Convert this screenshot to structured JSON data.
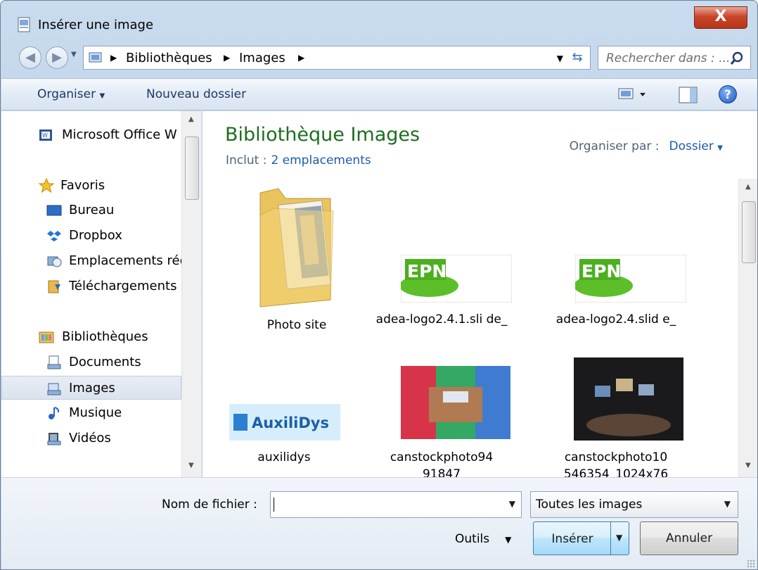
{
  "window": {
    "title": "Insérer une image",
    "close_label": "X"
  },
  "address": {
    "breadcrumbs": [
      "Bibliothèques",
      "Images"
    ],
    "search_placeholder": "Rechercher dans : ..."
  },
  "toolbar": {
    "organize_label": "Organiser",
    "new_folder_label": "Nouveau dossier",
    "help_label": "?"
  },
  "nav": {
    "items": [
      {
        "label": "Microsoft Office W",
        "icon": "word-icon"
      },
      {
        "label": "Favoris",
        "icon": "star-icon"
      },
      {
        "label": "Bureau",
        "icon": "desktop-icon"
      },
      {
        "label": "Dropbox",
        "icon": "dropbox-icon"
      },
      {
        "label": "Emplacements réc",
        "icon": "recent-places-icon"
      },
      {
        "label": "Téléchargements",
        "icon": "downloads-icon"
      },
      {
        "label": "Bibliothèques",
        "icon": "libraries-icon"
      },
      {
        "label": "Documents",
        "icon": "documents-icon"
      },
      {
        "label": "Images",
        "icon": "pictures-icon",
        "selected": true
      },
      {
        "label": "Musique",
        "icon": "music-icon"
      },
      {
        "label": "Vidéos",
        "icon": "videos-icon"
      }
    ]
  },
  "content": {
    "title": "Bibliothèque Images",
    "include_label": "Inclut :",
    "include_link": "2 emplacements",
    "arrange_label": "Organiser par :",
    "arrange_value": "Dossier",
    "tiles": [
      {
        "caption": "Photo site",
        "kind": "folder"
      },
      {
        "caption": "adea-logo2.4.1.sli de_",
        "kind": "logo",
        "logo_text": "EPN ADEA"
      },
      {
        "caption": "adea-logo2.4.slid e_",
        "kind": "logo",
        "logo_text": "EPN ADEA"
      },
      {
        "caption": "auxilidys",
        "kind": "banner",
        "logo_text": "AuxiliDys"
      },
      {
        "caption": "canstockphoto94 91847",
        "kind": "photo"
      },
      {
        "caption": "canstockphoto10 546354_1024x76",
        "kind": "photo"
      }
    ]
  },
  "bottom": {
    "filename_label": "Nom de fichier :",
    "filename_value": "",
    "filter_value": "Toutes les images",
    "tools_label": "Outils",
    "insert_label": "Insérer",
    "cancel_label": "Annuler"
  },
  "colors": {
    "title_green": "#1e6e1e",
    "link_blue": "#1e5aad",
    "close_red": "#c9452b"
  }
}
